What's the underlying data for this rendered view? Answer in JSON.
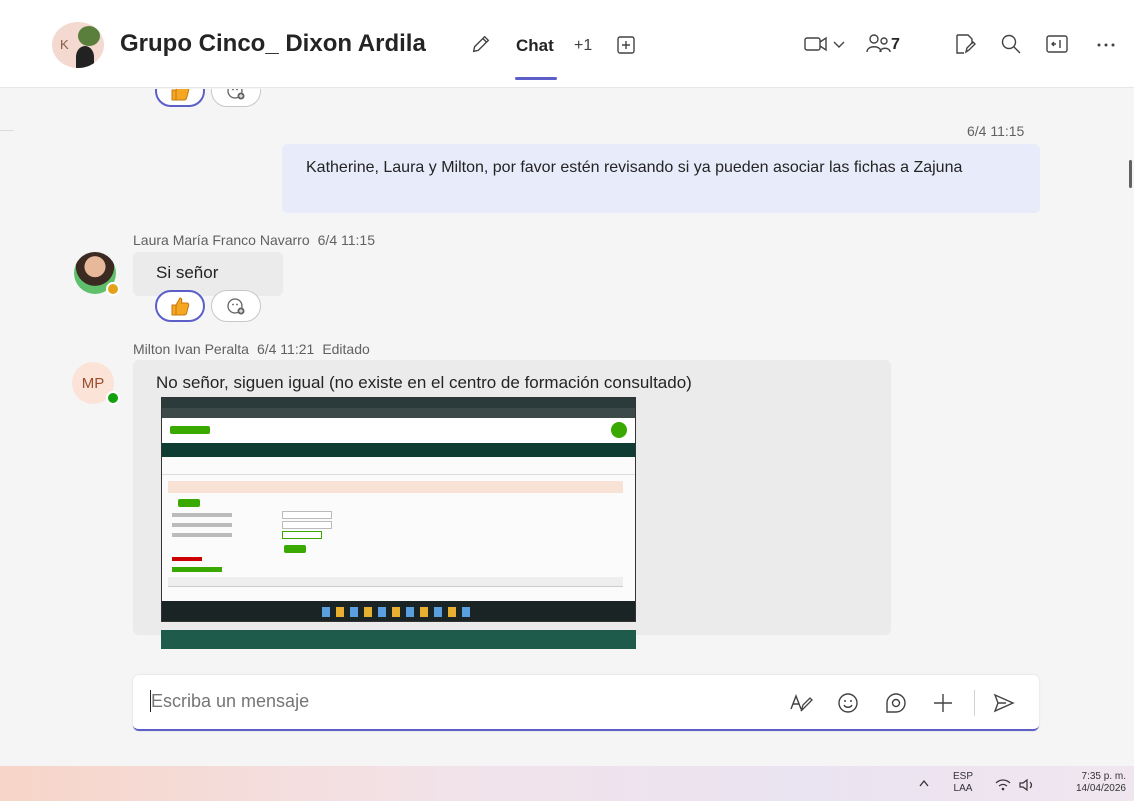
{
  "header": {
    "avatar_initial": "K",
    "title": "Grupo Cinco_ Dixon Ardila",
    "tab_chat": "Chat",
    "tab_more": "+1",
    "participants_count": "7"
  },
  "messages": {
    "my_timestamp": "6/4 11:15",
    "my_message": "Katherine, Laura y Milton, por favor estén revisando si ya pueden asociar las fichas a Zajuna",
    "laura": {
      "name": "Laura María Franco Navarro",
      "time": "6/4 11:15",
      "text": "Si señor"
    },
    "milton": {
      "initials": "MP",
      "name": "Milton Ivan Peralta",
      "time": "6/4 11:21",
      "edited": "Editado",
      "text": "No señor, siguen igual (no existe en el centro de formación consultado)"
    }
  },
  "composer": {
    "placeholder": "Escriba un mensaje"
  },
  "taskbar": {
    "lang_top": "ESP",
    "lang_bottom": "LAA",
    "time": "7:35 p. m.",
    "date": "14/04/2026"
  },
  "colors": {
    "accent": "#5b5fc7",
    "my_bubble": "#e8ebfa",
    "other_bubble": "#ebebeb",
    "online": "#13a10e",
    "away": "#e3a21a"
  }
}
